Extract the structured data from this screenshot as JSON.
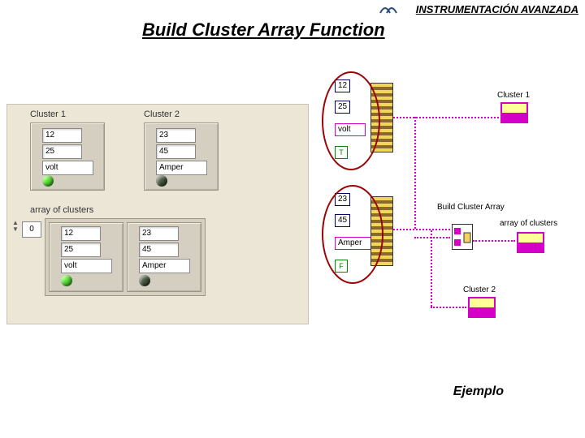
{
  "header": {
    "text": "INSTRUMENTACIÓN AVANZADA"
  },
  "title": "Build Cluster Array Function",
  "frontPanel": {
    "cluster1": {
      "label": "Cluster 1",
      "val1": "12",
      "val2": "25",
      "str": "volt",
      "bool": true
    },
    "cluster2": {
      "label": "Cluster 2",
      "val1": "23",
      "val2": "45",
      "str": "Amper",
      "bool": false
    },
    "arrayLabel": "array of clusters",
    "arrayIndex": "0",
    "arrayItems": [
      {
        "val1": "12",
        "val2": "25",
        "str": "volt",
        "bool": true
      },
      {
        "val1": "23",
        "val2": "45",
        "str": "Amper",
        "bool": false
      }
    ]
  },
  "blockDiagram": {
    "bundle1": {
      "n1": "12",
      "n2": "25",
      "s": "volt",
      "b": "T"
    },
    "bundle2": {
      "n1": "23",
      "n2": "45",
      "s": "Amper",
      "b": "F"
    },
    "cluster1Label": "Cluster 1",
    "cluster2Label": "Cluster 2",
    "bcaLabel": "Build Cluster Array",
    "arrLabel": "array of clusters"
  },
  "footer": "Ejemplo"
}
